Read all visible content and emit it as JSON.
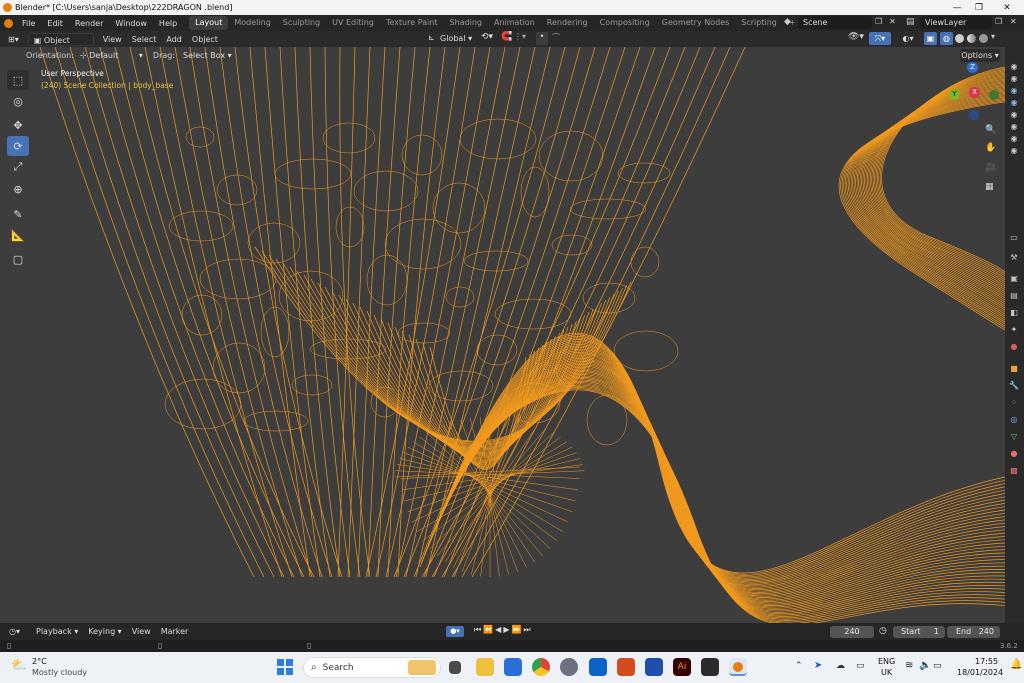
{
  "window": {
    "title": "Blender* [C:\\Users\\sanja\\Desktop\\222DRAGON .blend]",
    "controls": [
      "—",
      "❐",
      "✕"
    ]
  },
  "menus": [
    "File",
    "Edit",
    "Render",
    "Window",
    "Help"
  ],
  "workspaces": [
    "Layout",
    "Modeling",
    "Sculpting",
    "UV Editing",
    "Texture Paint",
    "Shading",
    "Animation",
    "Rendering",
    "Compositing",
    "Geometry Nodes",
    "Scripting"
  ],
  "active_workspace": "Layout",
  "add_workspace": "+",
  "scene": {
    "label": "Scene",
    "view_layer": "ViewLayer"
  },
  "header": {
    "mode": "Object Mode",
    "items": [
      "View",
      "Select",
      "Add",
      "Object"
    ],
    "transform_orientation": "Global"
  },
  "tool_settings": {
    "orientation_label": "Orientation:",
    "orientation_value": "Default",
    "drag_label": "Drag:",
    "drag_value": "Select Box",
    "options": "Options"
  },
  "viewport": {
    "view_name": "User Perspective",
    "collection": "(240) Scene Collection | body_base",
    "wire_color": "#f29a1e",
    "axis": {
      "x": "X",
      "y": "Y",
      "z": "Z"
    }
  },
  "timeline": {
    "items": [
      "Playback",
      "Keying",
      "View",
      "Marker"
    ],
    "current_frame": "240",
    "start_label": "Start",
    "start_value": "1",
    "end_label": "End",
    "end_value": "240"
  },
  "status": {
    "version": "3.6.2"
  },
  "taskbar": {
    "weather_temp": "2°C",
    "weather_desc": "Mostly cloudy",
    "search": "Search",
    "lang_top": "ENG",
    "lang_bottom": "UK",
    "time": "17:55",
    "date": "18/01/2024"
  }
}
